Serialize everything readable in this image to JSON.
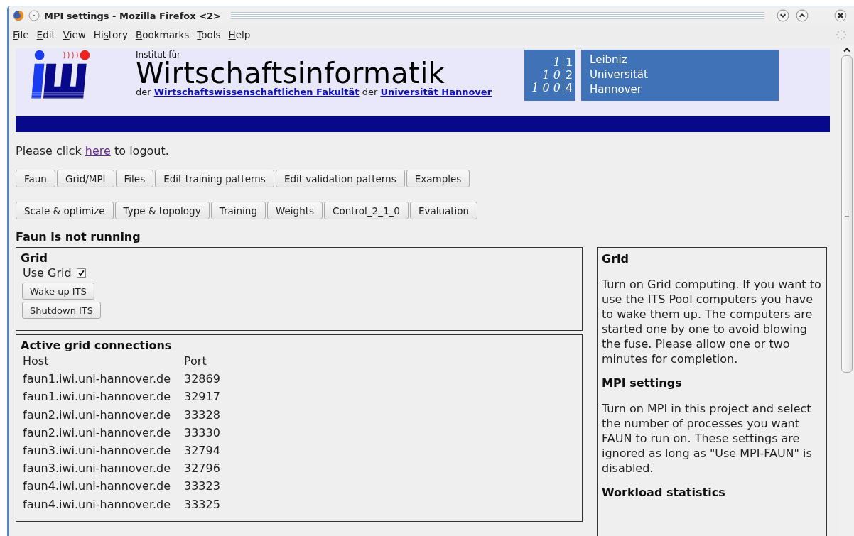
{
  "window": {
    "title": "MPI settings - Mozilla Firefox <2>"
  },
  "menu": [
    {
      "key": "F",
      "rest": "ile"
    },
    {
      "key": "E",
      "rest": "dit"
    },
    {
      "key": "V",
      "rest": "iew"
    },
    {
      "start": "Hi",
      "key": "s",
      "rest": "tory"
    },
    {
      "key": "B",
      "rest": "ookmarks"
    },
    {
      "key": "T",
      "rest": "ools"
    },
    {
      "key": "H",
      "rest": "elp"
    }
  ],
  "header": {
    "prefix": "Institut für",
    "title": "Wirtschaftsinformatik",
    "subtitle": [
      {
        "kind": "text",
        "text": "der "
      },
      {
        "kind": "link",
        "text": "Wirtschaftswissenschaftlichen Fakultät"
      },
      {
        "kind": "text",
        "text": " der "
      },
      {
        "kind": "link",
        "text": "Universität Hannover"
      }
    ],
    "seal_rows": [
      [
        "1",
        "1"
      ],
      [
        "1 0",
        "2"
      ],
      [
        "1 0 0",
        "4"
      ]
    ],
    "university": [
      "Leibniz",
      "Universität",
      "Hannover"
    ]
  },
  "logout": [
    {
      "kind": "text",
      "text": "Please click "
    },
    {
      "kind": "link",
      "text": "here",
      "visited": true
    },
    {
      "kind": "text",
      "text": " to logout."
    }
  ],
  "tab_rows": [
    [
      "Faun",
      "Grid/MPI",
      "Files",
      "Edit training patterns",
      "Edit validation patterns",
      "Examples"
    ],
    [
      "Scale & optimize",
      "Type & topology",
      "Training",
      "Weights",
      "Control_2_1_0",
      "Evaluation"
    ]
  ],
  "status": "Faun is not running",
  "grid_panel": {
    "title": "Grid",
    "checkbox": {
      "label": "Use Grid",
      "checked": true
    },
    "buttons": [
      "Wake up ITS",
      "Shutdown ITS"
    ]
  },
  "connections": {
    "title": "Active grid connections",
    "columns": [
      "Host",
      "Port"
    ],
    "rows": [
      [
        "faun1.iwi.uni-hannover.de",
        "32869"
      ],
      [
        "faun1.iwi.uni-hannover.de",
        "32917"
      ],
      [
        "faun2.iwi.uni-hannover.de",
        "33328"
      ],
      [
        "faun2.iwi.uni-hannover.de",
        "33330"
      ],
      [
        "faun3.iwi.uni-hannover.de",
        "32794"
      ],
      [
        "faun3.iwi.uni-hannover.de",
        "32796"
      ],
      [
        "faun4.iwi.uni-hannover.de",
        "33323"
      ],
      [
        "faun4.iwi.uni-hannover.de",
        "33325"
      ]
    ]
  },
  "help": [
    {
      "heading": "Grid",
      "text": "Turn on Grid computing. If you want to use the ITS Pool computers you have to wake them up. The computers are started one by one to avoid blowing the fuse. Please allow one or two minutes for completion."
    },
    {
      "heading": "MPI settings",
      "text": "Turn on MPI in this project and select the number of processes you want FAUN to run on. These settings are ignored as long as \"Use MPI-FAUN\" is disabled."
    },
    {
      "heading": "Workload statistics"
    }
  ]
}
